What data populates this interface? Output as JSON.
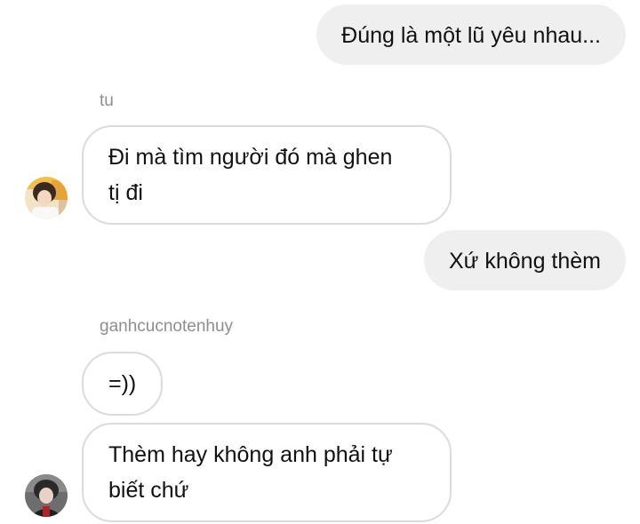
{
  "messages": [
    {
      "from": "me",
      "text": "Đúng là một lũ yêu nhau..."
    },
    {
      "from": "tu",
      "sender": "tu",
      "lines": [
        "Đi mà tìm người đó mà ghen",
        "tị đi"
      ]
    },
    {
      "from": "me",
      "text": "Xứ không thèm"
    },
    {
      "from": "ganhcucnotenhuy",
      "sender": "ganhcucnotenhuy",
      "text": "=))"
    },
    {
      "from": "ganhcucnotenhuy",
      "lines": [
        "Thèm hay không anh phải tự",
        "biết chứ"
      ]
    }
  ],
  "colors": {
    "sent_bubble": "#efefef",
    "recv_border": "#dbdbdb",
    "sender_name": "#8e8e8e"
  }
}
